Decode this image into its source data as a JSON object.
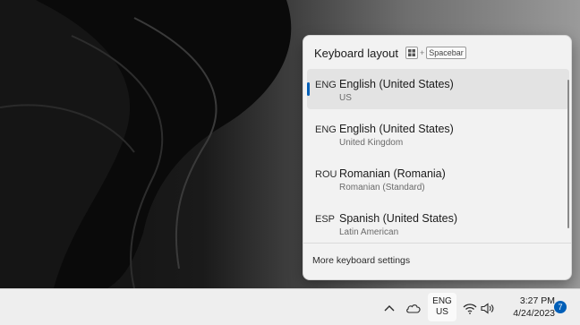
{
  "flyout": {
    "title": "Keyboard layout",
    "shortcut": {
      "plus": "+",
      "key": "Spacebar",
      "win_icon": "windows-key-icon"
    },
    "layouts": [
      {
        "code": "ENG",
        "name": "English (United States)",
        "variant": "US",
        "selected": true
      },
      {
        "code": "ENG",
        "name": "English (United States)",
        "variant": "United Kingdom",
        "selected": false
      },
      {
        "code": "ROU",
        "name": "Romanian (Romania)",
        "variant": "Romanian (Standard)",
        "selected": false
      },
      {
        "code": "ESP",
        "name": "Spanish (United States)",
        "variant": "Latin American",
        "selected": false
      }
    ],
    "more_settings": "More keyboard settings"
  },
  "taskbar": {
    "ime": {
      "top": "ENG",
      "bottom": "US"
    },
    "clock": {
      "time": "3:27 PM",
      "date": "4/24/2023"
    },
    "notification_count": "7",
    "icons": [
      "chevron-up-icon",
      "onedrive-icon",
      "wifi-icon",
      "speaker-icon"
    ]
  },
  "colors": {
    "accent": "#005fb8",
    "flyout_bg": "#f2f2f2",
    "taskbar_bg": "#eeeeee"
  }
}
